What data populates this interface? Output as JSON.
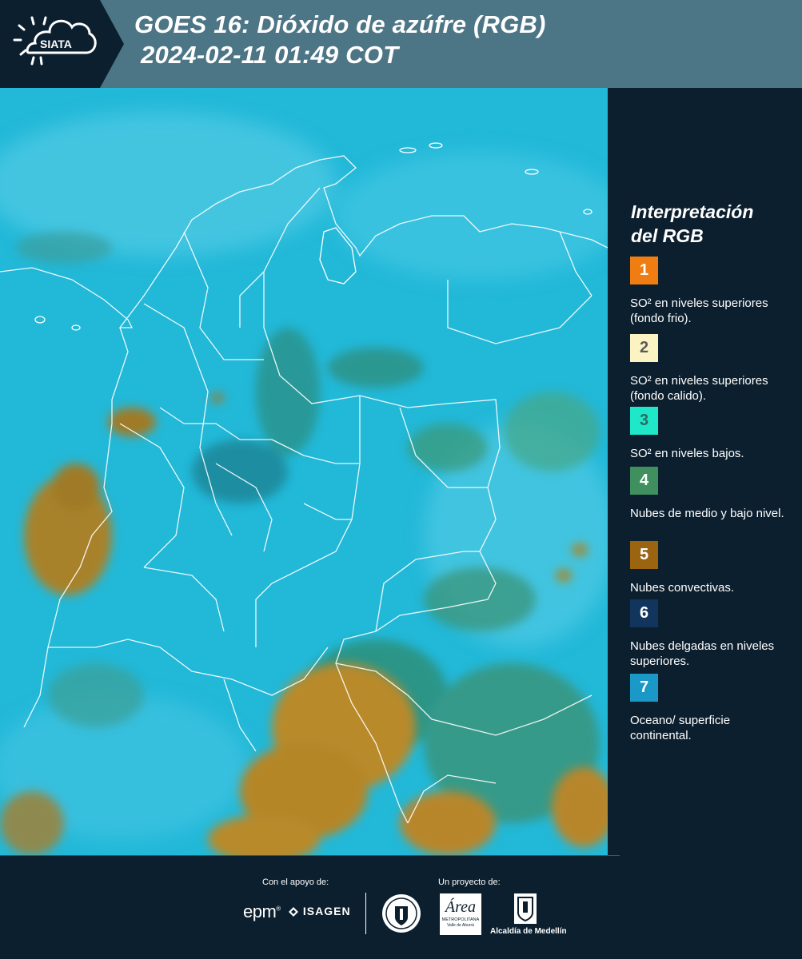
{
  "header": {
    "logo_text": "SIATA",
    "title_line1": "GOES 16: Dióxido de azúfre (RGB)",
    "title_line2": "2024-02-11 01:49 COT"
  },
  "legend": {
    "title_line1": "Interpretación",
    "title_line2": "del RGB",
    "items": [
      {
        "number": "1",
        "color": "#f07d12",
        "text_color": "#ffffff",
        "text": "SO² en niveles superiores (fondo frio)."
      },
      {
        "number": "2",
        "color": "#fbf3c2",
        "text_color": "#5a5a5a",
        "text": "SO² en niveles superiores (fondo calido)."
      },
      {
        "number": "3",
        "color": "#1ee8c8",
        "text_color": "#2a6b63",
        "text": "SO² en niveles bajos."
      },
      {
        "number": "4",
        "color": "#3f8f5f",
        "text_color": "#ffffff",
        "text": "Nubes de medio y bajo nivel."
      },
      {
        "number": "5",
        "color": "#9a6411",
        "text_color": "#ffffff",
        "text": "Nubes convectivas."
      },
      {
        "number": "6",
        "color": "#12355e",
        "text_color": "#ffffff",
        "text": "Nubes delgadas en niveles superiores."
      },
      {
        "number": "7",
        "color": "#1a98c7",
        "text_color": "#ffffff",
        "text": "Oceano/ superficie continental."
      }
    ]
  },
  "footer": {
    "support_label": "Con el apoyo de:",
    "project_label": "Un proyecto de:",
    "sponsor_epm": "epm",
    "sponsor_isagen": "ISAGEN",
    "sponsor_area_script": "Área",
    "sponsor_area_small": "METROPOLITANA",
    "sponsor_area_small2": "Valle de Aburrá",
    "sponsor_alcaldia": "Alcaldía de Medellín"
  },
  "colors": {
    "header_bg": "#4c7586",
    "panel_bg": "#0c1f2e",
    "map_base": "#22b8d8",
    "cloud_convective": "#b8862a",
    "cloud_mid": "#3f8f5f"
  }
}
